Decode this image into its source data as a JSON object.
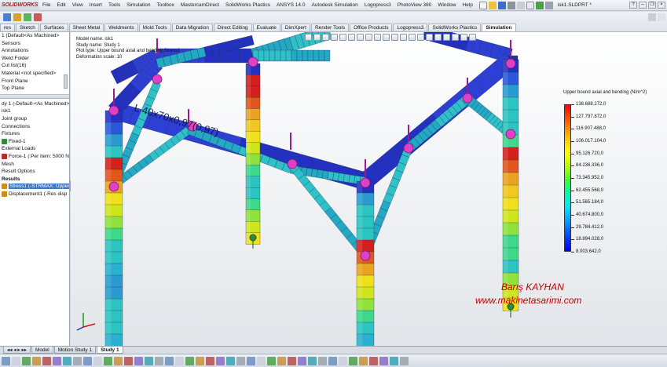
{
  "app": {
    "logo": "SOLIDWORKS",
    "document_name": "isk1.SLDPRT *"
  },
  "menu": [
    "File",
    "Edit",
    "View",
    "Insert",
    "Tools",
    "Simulation",
    "Toolbox",
    "MastercamDirect",
    "SolidWorks Plastics",
    "ANSYS 14.0",
    "Autodesk Simulation",
    "Logopress3",
    "PhotoView 360",
    "Window",
    "Help"
  ],
  "tabs": [
    "res",
    "Sketch",
    "Surfaces",
    "Sheet Metal",
    "Weldments",
    "Mold Tools",
    "Data Migration",
    "Direct Editing",
    "Evaluate",
    "DimXpert",
    "Render Tools",
    "Office Products",
    "Logopress3",
    "SolidWorks Plastics",
    "Simulation"
  ],
  "active_tab": "Simulation",
  "feature_tree": [
    {
      "label": "1 (Default<As Machined>",
      "bold": false
    },
    {
      "label": "Sensors",
      "bold": false
    },
    {
      "label": "Annotations",
      "bold": false
    },
    {
      "label": "Weld Folder",
      "bold": false
    },
    {
      "label": "Cut list(16)",
      "bold": false
    },
    {
      "label": "Material <not specified>",
      "bold": false
    },
    {
      "label": "Front Plane",
      "bold": false
    },
    {
      "label": "Top Plane",
      "bold": false
    }
  ],
  "study_tree": [
    {
      "label": "dy 1 (-Default-<As Machined>",
      "bold": false,
      "icon": ""
    },
    {
      "label": "isk1",
      "bold": false,
      "icon": ""
    },
    {
      "label": "Joint group",
      "bold": false,
      "icon": ""
    },
    {
      "label": "Connections",
      "bold": false,
      "icon": ""
    },
    {
      "label": "Fixtures",
      "bold": false,
      "icon": ""
    },
    {
      "label": "Fixed-1",
      "bold": false,
      "icon": "fixture-icon"
    },
    {
      "label": "External Loads",
      "bold": false,
      "icon": ""
    },
    {
      "label": "Force-1 (:Per item: 5000 N",
      "bold": false,
      "icon": "force-icon"
    },
    {
      "label": "Mesh",
      "bold": false,
      "icon": ""
    },
    {
      "label": "Result Options",
      "bold": false,
      "icon": ""
    },
    {
      "label": "Results",
      "bold": true,
      "icon": ""
    },
    {
      "label": "Stress1 (-STRMAX: Upper",
      "bold": false,
      "icon": "result-icon",
      "selected": true
    },
    {
      "label": "Displacement1 (-Res disp",
      "bold": false,
      "icon": "result-icon"
    }
  ],
  "study_info": {
    "model_name": "Model name: isk1",
    "study_name": "Study name: Study 1",
    "plot_type": "Plot type: Upper bound axial and bending Stress1",
    "deformation_scale": "Deformation scale: 10"
  },
  "legend": {
    "title": "Upper bound axial and bending (N/m^2)",
    "values": [
      "138.688.272,0",
      "127.797.872,0",
      "116.907.488,0",
      "106.017.104,0",
      "95.126.720,0",
      "84.236.336,0",
      "73.345.952,0",
      "62.455.568,0",
      "51.565.184,0",
      "40.674.800,0",
      "29.784.412,0",
      "18.894.028,0",
      "8.003.642,0"
    ],
    "colors": {
      "max": "#ff0000",
      "mid": "#33ff33",
      "min": "#0000ff"
    }
  },
  "beam_label": "L 40x70x0,97(0,97)",
  "watermark": {
    "name": "Barış KAYHAN",
    "site": "www.makinetasarimi.com"
  },
  "bottom_tabs": [
    "Model",
    "Motion Study 1",
    "Study 1"
  ],
  "active_bottom_tab": "Study 1",
  "colors": {
    "node": "#e040c8",
    "beam_blue": "#2a35c8",
    "beam_cyan": "#28b0c8",
    "accent": "#3a78c8"
  }
}
